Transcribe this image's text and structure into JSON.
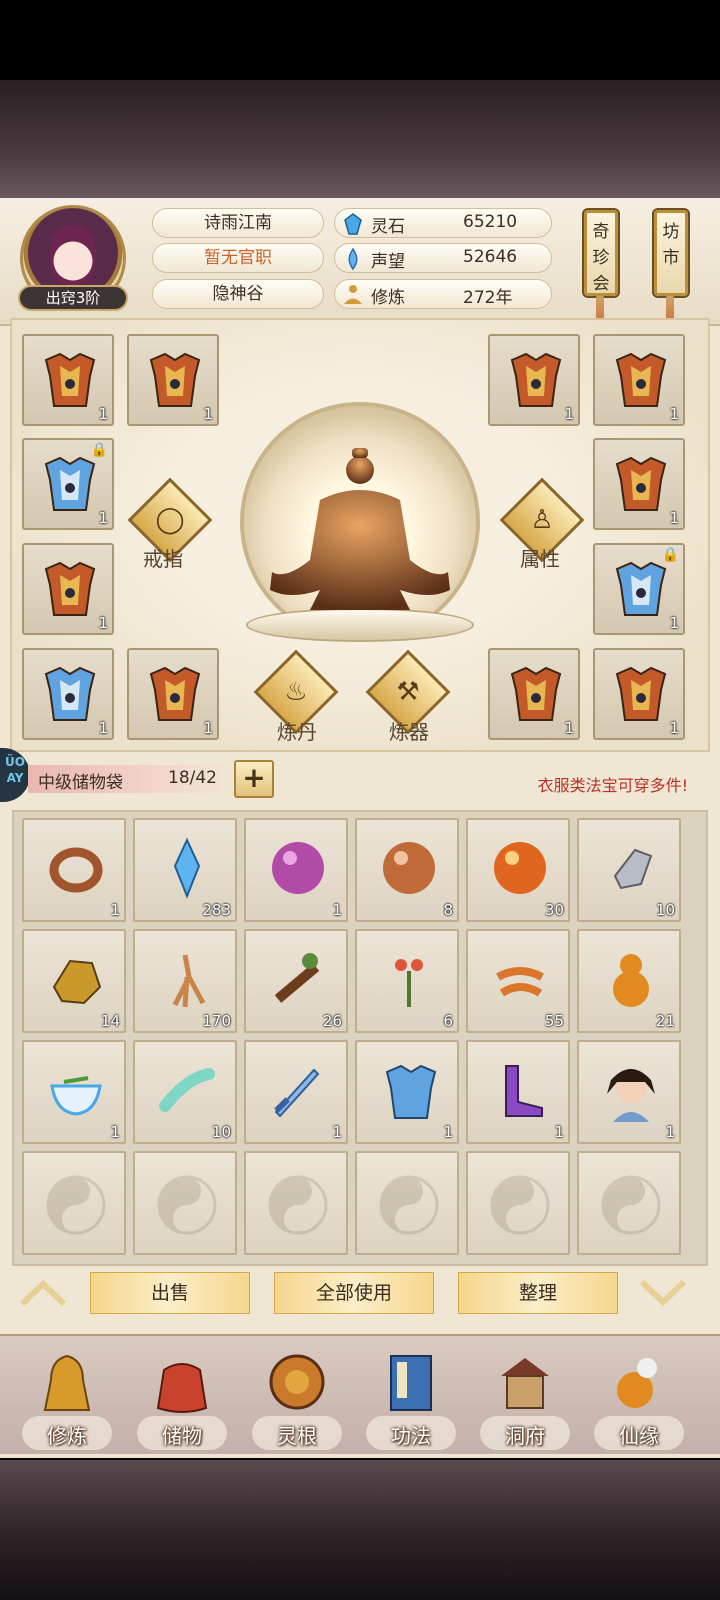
{
  "player": {
    "name": "诗雨江南",
    "title": "暂无官职",
    "sect": "隐神谷",
    "rank": "出窍3阶"
  },
  "resources": [
    {
      "icon": "spirit-stone-icon",
      "label": "灵石",
      "value": "65210"
    },
    {
      "icon": "prestige-icon",
      "label": "声望",
      "value": "52646"
    },
    {
      "icon": "cultivation-icon",
      "label": "修炼",
      "value": "272年"
    }
  ],
  "side_buttons": {
    "treasure_fair": "奇珍会",
    "market": "坊市"
  },
  "equipment": {
    "counts": [
      "1",
      "1",
      "1",
      "1",
      "1",
      "1",
      "1",
      "1",
      "1",
      "1",
      "1",
      "1"
    ],
    "ring": "戒指",
    "attributes": "属性",
    "alchemy": "炼丹",
    "forging": "炼器"
  },
  "bag": {
    "name": "中级储物袋",
    "capacity": "18/42",
    "add_label": "+",
    "hint": "衣服类法宝可穿多件!",
    "side_badge": "ÜO AY",
    "items": [
      {
        "icon": "ring-icon",
        "count": "1"
      },
      {
        "icon": "blue-crystal-icon",
        "count": "283"
      },
      {
        "icon": "purple-orb-icon",
        "count": "1"
      },
      {
        "icon": "bronze-orb-icon",
        "count": "8"
      },
      {
        "icon": "fire-orb-icon",
        "count": "30"
      },
      {
        "icon": "silver-ore-icon",
        "count": "10"
      },
      {
        "icon": "gold-ore-icon",
        "count": "14"
      },
      {
        "icon": "ginseng-icon",
        "count": "170"
      },
      {
        "icon": "herb-root-icon",
        "count": "26"
      },
      {
        "icon": "flower-herb-icon",
        "count": "6"
      },
      {
        "icon": "cordyceps-icon",
        "count": "55"
      },
      {
        "icon": "gourd-icon",
        "count": "21"
      },
      {
        "icon": "tea-bowl-icon",
        "count": "1"
      },
      {
        "icon": "jade-scroll-icon",
        "count": "10"
      },
      {
        "icon": "sword-icon",
        "count": "1"
      },
      {
        "icon": "blue-armor-icon",
        "count": "1"
      },
      {
        "icon": "purple-boots-icon",
        "count": "1"
      },
      {
        "icon": "hero-portrait-icon",
        "count": "1"
      }
    ]
  },
  "actions": {
    "sell": "出售",
    "use_all": "全部使用",
    "sort": "整理"
  },
  "nav": [
    {
      "icon": "cultivate-icon",
      "label": "修炼"
    },
    {
      "icon": "storage-icon",
      "label": "储物"
    },
    {
      "icon": "spirit-root-icon",
      "label": "灵根"
    },
    {
      "icon": "skills-book-icon",
      "label": "功法"
    },
    {
      "icon": "cave-dwelling-icon",
      "label": "洞府"
    },
    {
      "icon": "fortune-icon",
      "label": "仙缘"
    }
  ],
  "colors": {
    "accent_gold": "#d7a94b",
    "hint_red": "#b8322a",
    "panel_bg": "#efe6d4"
  }
}
